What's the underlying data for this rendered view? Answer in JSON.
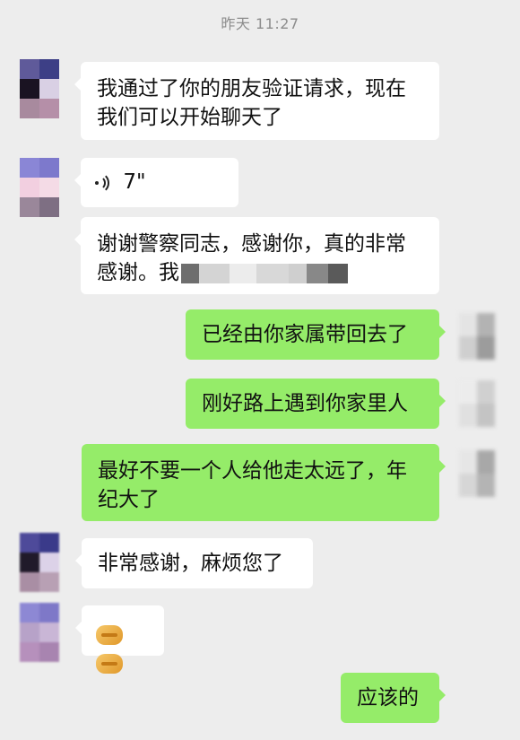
{
  "chat": {
    "timestamp": "昨天 11:27",
    "messages": [
      {
        "side": "in",
        "type": "text",
        "text_line1": "我通过了你的朋友验证请求，现在",
        "text_line2": "我们可以开始聊天了"
      },
      {
        "side": "in",
        "type": "voice",
        "duration": "7\""
      },
      {
        "side": "in",
        "type": "text",
        "text_line1": "谢谢警察同志，感谢你，真的非常",
        "text_line2": "感谢。我",
        "redacted": true
      },
      {
        "side": "out",
        "type": "text",
        "text": "已经由你家属带回去了"
      },
      {
        "side": "out",
        "type": "text",
        "text": "刚好路上遇到你家里人"
      },
      {
        "side": "out",
        "type": "text",
        "text_line1": "最好不要一个人给他走太远了，年",
        "text_line2": "纪大了"
      },
      {
        "side": "in",
        "type": "text",
        "text": "非常感谢，麻烦您了"
      },
      {
        "side": "in",
        "type": "emoji",
        "emoji": "handshake",
        "count": 2
      },
      {
        "side": "out",
        "type": "text",
        "text": "应该的"
      }
    ]
  },
  "colors": {
    "background": "#ededed",
    "incoming_bubble": "#ffffff",
    "outgoing_bubble": "#95ec69",
    "timestamp_text": "#8c8c8c"
  },
  "icons": {
    "voice": "voice-wave-icon",
    "emoji": "handshake-emoji-icon"
  }
}
